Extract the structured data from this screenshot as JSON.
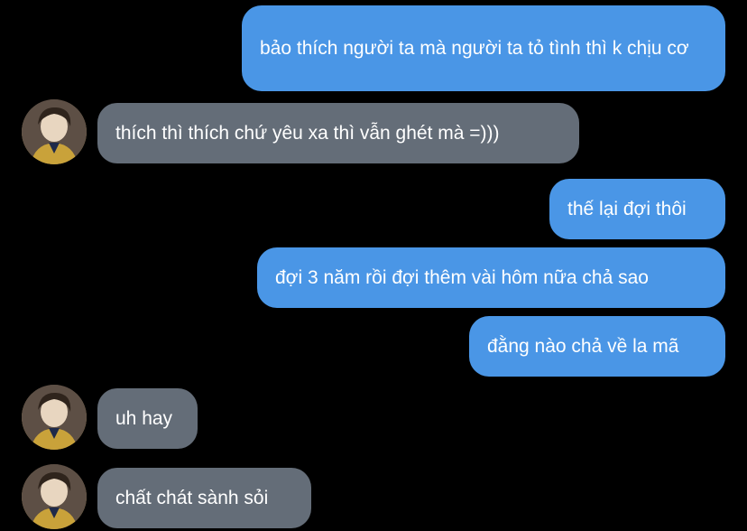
{
  "messages": [
    {
      "direction": "outgoing",
      "text": "bảo thích người ta mà người ta tỏ tình thì k chịu cơ"
    },
    {
      "direction": "incoming",
      "text": "thích thì thích chứ yêu xa thì vẫn ghét mà =)))"
    },
    {
      "direction": "outgoing",
      "text": "thế lại đợi thôi"
    },
    {
      "direction": "outgoing",
      "text": "đợi 3 năm rồi đợi thêm vài hôm nữa chả sao"
    },
    {
      "direction": "outgoing",
      "text": "đằng nào chả về la mã"
    },
    {
      "direction": "incoming",
      "text": "uh hay"
    },
    {
      "direction": "incoming",
      "text": "chất chát sành sỏi"
    }
  ],
  "colors": {
    "background": "#000000",
    "outgoing_bubble": "#4a96e6",
    "incoming_bubble": "#646d78",
    "text": "#ffffff"
  },
  "icons": {
    "avatar": "contact-avatar-photo"
  }
}
